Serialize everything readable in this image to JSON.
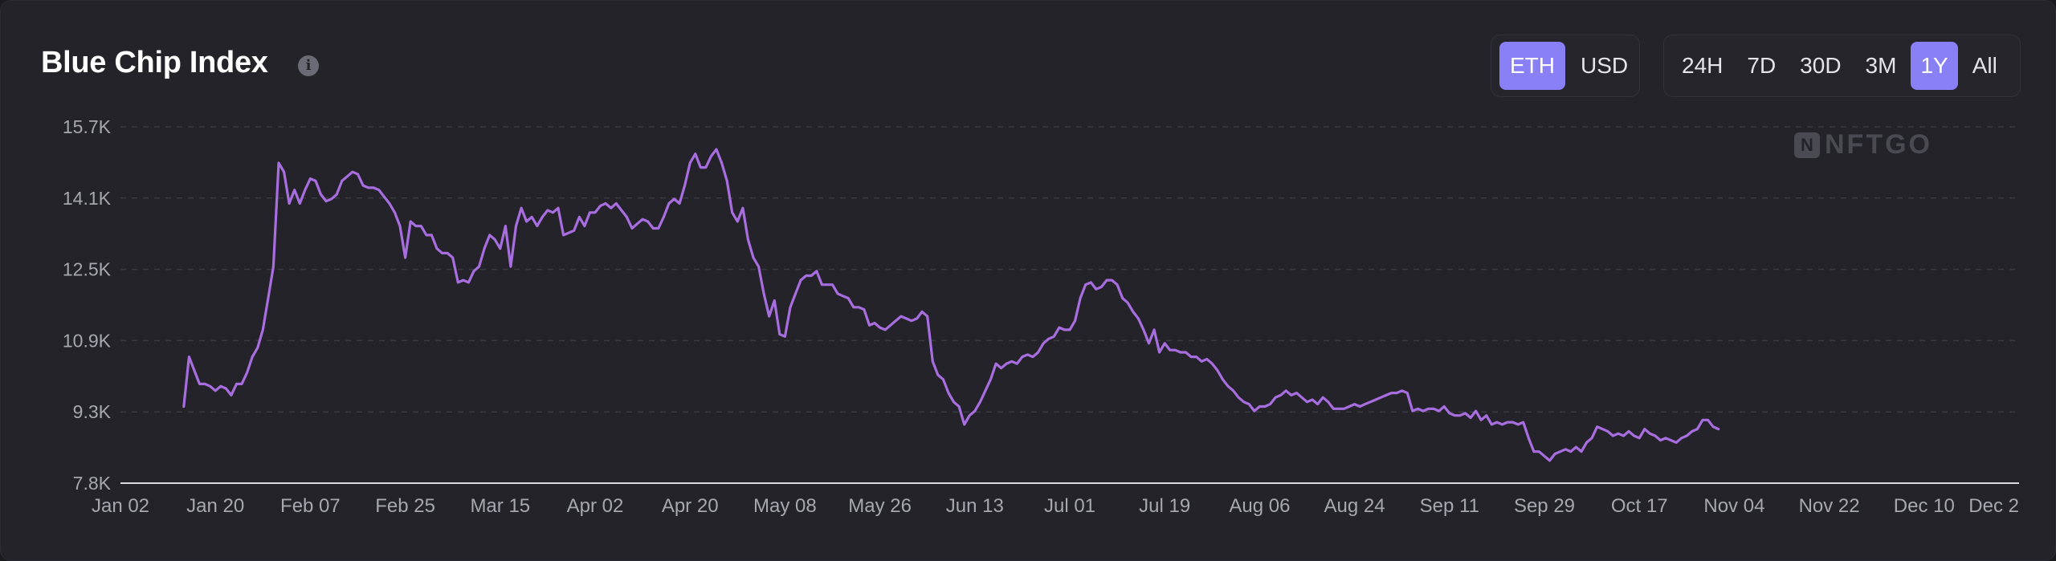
{
  "title": "Blue Chip Index",
  "currency": {
    "options": [
      "ETH",
      "USD"
    ],
    "selected": "ETH"
  },
  "ranges": {
    "options": [
      "24H",
      "7D",
      "30D",
      "3M",
      "1Y",
      "All"
    ],
    "selected": "1Y"
  },
  "watermark": "NFTGO",
  "colors": {
    "line": "#a86ee0",
    "accent": "#8a80f5",
    "background": "#232329"
  },
  "chart_data": {
    "type": "line",
    "title": "Blue Chip Index",
    "xlabel": "",
    "ylabel": "",
    "ylim": [
      7.8,
      15.7
    ],
    "y_ticks": [
      "15.7K",
      "14.1K",
      "12.5K",
      "10.9K",
      "9.3K",
      "7.8K"
    ],
    "x_ticks": [
      "Jan 02",
      "Jan 20",
      "Feb 07",
      "Feb 25",
      "Mar 15",
      "Apr 02",
      "Apr 20",
      "May 08",
      "May 26",
      "Jun 13",
      "Jul 01",
      "Jul 19",
      "Aug 06",
      "Aug 24",
      "Sep 11",
      "Sep 29",
      "Oct 17",
      "Nov 04",
      "Nov 22",
      "Dec 10",
      "Dec 2"
    ],
    "grid": true,
    "series": [
      {
        "points": [
          [
            12,
            9.5
          ],
          [
            13,
            10.6
          ],
          [
            14,
            10.3
          ],
          [
            15,
            10.0
          ],
          [
            16,
            10.0
          ],
          [
            17,
            9.95
          ],
          [
            18,
            9.85
          ],
          [
            19,
            9.95
          ],
          [
            20,
            9.9
          ],
          [
            21,
            9.75
          ],
          [
            22,
            10.0
          ],
          [
            23,
            10.0
          ],
          [
            24,
            10.25
          ],
          [
            25,
            10.6
          ],
          [
            26,
            10.8
          ],
          [
            27,
            11.2
          ],
          [
            28,
            11.9
          ],
          [
            29,
            12.6
          ],
          [
            30,
            14.9
          ],
          [
            31,
            14.7
          ],
          [
            32,
            14.0
          ],
          [
            33,
            14.3
          ],
          [
            34,
            14.0
          ],
          [
            35,
            14.3
          ],
          [
            36,
            14.55
          ],
          [
            37,
            14.5
          ],
          [
            38,
            14.2
          ],
          [
            39,
            14.05
          ],
          [
            40,
            14.1
          ],
          [
            41,
            14.2
          ],
          [
            42,
            14.5
          ],
          [
            43,
            14.6
          ],
          [
            44,
            14.7
          ],
          [
            45,
            14.65
          ],
          [
            46,
            14.4
          ],
          [
            47,
            14.35
          ],
          [
            48,
            14.35
          ],
          [
            49,
            14.3
          ],
          [
            50,
            14.15
          ],
          [
            51,
            14.0
          ],
          [
            52,
            13.8
          ],
          [
            53,
            13.5
          ],
          [
            54,
            12.8
          ],
          [
            55,
            13.6
          ],
          [
            56,
            13.5
          ],
          [
            57,
            13.5
          ],
          [
            58,
            13.3
          ],
          [
            59,
            13.3
          ],
          [
            60,
            13.0
          ],
          [
            61,
            12.9
          ],
          [
            62,
            12.9
          ],
          [
            63,
            12.8
          ],
          [
            64,
            12.25
          ],
          [
            65,
            12.3
          ],
          [
            66,
            12.25
          ],
          [
            67,
            12.5
          ],
          [
            68,
            12.6
          ],
          [
            69,
            13.0
          ],
          [
            70,
            13.3
          ],
          [
            71,
            13.2
          ],
          [
            72,
            13.0
          ],
          [
            73,
            13.5
          ],
          [
            74,
            12.6
          ],
          [
            75,
            13.5
          ],
          [
            76,
            13.9
          ],
          [
            77,
            13.6
          ],
          [
            78,
            13.7
          ],
          [
            79,
            13.5
          ],
          [
            80,
            13.7
          ],
          [
            81,
            13.85
          ],
          [
            82,
            13.8
          ],
          [
            83,
            13.9
          ],
          [
            84,
            13.3
          ],
          [
            85,
            13.35
          ],
          [
            86,
            13.4
          ],
          [
            87,
            13.7
          ],
          [
            88,
            13.5
          ],
          [
            89,
            13.8
          ],
          [
            90,
            13.8
          ],
          [
            91,
            13.95
          ],
          [
            92,
            14.0
          ],
          [
            93,
            13.9
          ],
          [
            94,
            14.0
          ],
          [
            95,
            13.85
          ],
          [
            96,
            13.7
          ],
          [
            97,
            13.45
          ],
          [
            98,
            13.55
          ],
          [
            99,
            13.65
          ],
          [
            100,
            13.6
          ],
          [
            101,
            13.45
          ],
          [
            102,
            13.45
          ],
          [
            103,
            13.7
          ],
          [
            104,
            14.0
          ],
          [
            105,
            14.1
          ],
          [
            106,
            14.0
          ],
          [
            107,
            14.4
          ],
          [
            108,
            14.9
          ],
          [
            109,
            15.1
          ],
          [
            110,
            14.8
          ],
          [
            111,
            14.8
          ],
          [
            112,
            15.05
          ],
          [
            113,
            15.2
          ],
          [
            114,
            14.9
          ],
          [
            115,
            14.5
          ],
          [
            116,
            13.8
          ],
          [
            117,
            13.6
          ],
          [
            118,
            13.9
          ],
          [
            119,
            13.2
          ],
          [
            120,
            12.8
          ],
          [
            121,
            12.6
          ],
          [
            122,
            12.0
          ],
          [
            123,
            11.5
          ],
          [
            124,
            11.85
          ],
          [
            125,
            11.1
          ],
          [
            126,
            11.05
          ],
          [
            127,
            11.7
          ],
          [
            128,
            12.0
          ],
          [
            129,
            12.3
          ],
          [
            130,
            12.4
          ],
          [
            131,
            12.4
          ],
          [
            132,
            12.5
          ],
          [
            133,
            12.2
          ],
          [
            134,
            12.2
          ],
          [
            135,
            12.2
          ],
          [
            136,
            12.0
          ],
          [
            137,
            11.95
          ],
          [
            138,
            11.9
          ],
          [
            139,
            11.7
          ],
          [
            140,
            11.7
          ],
          [
            141,
            11.65
          ],
          [
            142,
            11.3
          ],
          [
            143,
            11.35
          ],
          [
            144,
            11.25
          ],
          [
            145,
            11.2
          ],
          [
            146,
            11.3
          ],
          [
            147,
            11.4
          ],
          [
            148,
            11.5
          ],
          [
            149,
            11.45
          ],
          [
            150,
            11.4
          ],
          [
            151,
            11.45
          ],
          [
            152,
            11.6
          ],
          [
            153,
            11.5
          ],
          [
            154,
            10.5
          ],
          [
            155,
            10.2
          ],
          [
            156,
            10.1
          ],
          [
            157,
            9.8
          ],
          [
            158,
            9.6
          ],
          [
            159,
            9.5
          ],
          [
            160,
            9.1
          ],
          [
            161,
            9.3
          ],
          [
            162,
            9.4
          ],
          [
            163,
            9.6
          ],
          [
            164,
            9.85
          ],
          [
            165,
            10.1
          ],
          [
            166,
            10.45
          ],
          [
            167,
            10.35
          ],
          [
            168,
            10.45
          ],
          [
            169,
            10.5
          ],
          [
            170,
            10.45
          ],
          [
            171,
            10.6
          ],
          [
            172,
            10.65
          ],
          [
            173,
            10.6
          ],
          [
            174,
            10.7
          ],
          [
            175,
            10.9
          ],
          [
            176,
            11.0
          ],
          [
            177,
            11.05
          ],
          [
            178,
            11.25
          ],
          [
            179,
            11.2
          ],
          [
            180,
            11.2
          ],
          [
            181,
            11.4
          ],
          [
            182,
            11.9
          ],
          [
            183,
            12.2
          ],
          [
            184,
            12.25
          ],
          [
            185,
            12.1
          ],
          [
            186,
            12.15
          ],
          [
            187,
            12.3
          ],
          [
            188,
            12.3
          ],
          [
            189,
            12.2
          ],
          [
            190,
            11.9
          ],
          [
            191,
            11.8
          ],
          [
            192,
            11.6
          ],
          [
            193,
            11.45
          ],
          [
            194,
            11.2
          ],
          [
            195,
            10.9
          ],
          [
            196,
            11.2
          ],
          [
            197,
            10.7
          ],
          [
            198,
            10.9
          ],
          [
            199,
            10.75
          ],
          [
            200,
            10.75
          ],
          [
            201,
            10.7
          ],
          [
            202,
            10.7
          ],
          [
            203,
            10.6
          ],
          [
            204,
            10.6
          ],
          [
            205,
            10.5
          ],
          [
            206,
            10.55
          ],
          [
            207,
            10.45
          ],
          [
            208,
            10.3
          ],
          [
            209,
            10.1
          ],
          [
            210,
            9.95
          ],
          [
            211,
            9.85
          ],
          [
            212,
            9.7
          ],
          [
            213,
            9.6
          ],
          [
            214,
            9.55
          ],
          [
            215,
            9.4
          ],
          [
            216,
            9.5
          ],
          [
            217,
            9.5
          ],
          [
            218,
            9.55
          ],
          [
            219,
            9.7
          ],
          [
            220,
            9.75
          ],
          [
            221,
            9.85
          ],
          [
            222,
            9.75
          ],
          [
            223,
            9.8
          ],
          [
            224,
            9.7
          ],
          [
            225,
            9.6
          ],
          [
            226,
            9.65
          ],
          [
            227,
            9.55
          ],
          [
            228,
            9.7
          ],
          [
            229,
            9.6
          ],
          [
            230,
            9.45
          ],
          [
            231,
            9.45
          ],
          [
            232,
            9.45
          ],
          [
            233,
            9.5
          ],
          [
            234,
            9.55
          ],
          [
            235,
            9.5
          ],
          [
            236,
            9.55
          ],
          [
            237,
            9.6
          ],
          [
            238,
            9.65
          ],
          [
            239,
            9.7
          ],
          [
            240,
            9.75
          ],
          [
            241,
            9.8
          ],
          [
            242,
            9.8
          ],
          [
            243,
            9.85
          ],
          [
            244,
            9.8
          ],
          [
            245,
            9.4
          ],
          [
            246,
            9.45
          ],
          [
            247,
            9.4
          ],
          [
            248,
            9.45
          ],
          [
            249,
            9.45
          ],
          [
            250,
            9.4
          ],
          [
            251,
            9.5
          ],
          [
            252,
            9.35
          ],
          [
            253,
            9.3
          ],
          [
            254,
            9.3
          ],
          [
            255,
            9.35
          ],
          [
            256,
            9.25
          ],
          [
            257,
            9.4
          ],
          [
            258,
            9.2
          ],
          [
            259,
            9.3
          ],
          [
            260,
            9.1
          ],
          [
            261,
            9.15
          ],
          [
            262,
            9.1
          ],
          [
            263,
            9.15
          ],
          [
            264,
            9.15
          ],
          [
            265,
            9.1
          ],
          [
            266,
            9.15
          ],
          [
            267,
            8.8
          ],
          [
            268,
            8.5
          ],
          [
            269,
            8.5
          ],
          [
            270,
            8.4
          ],
          [
            271,
            8.3
          ],
          [
            272,
            8.45
          ],
          [
            273,
            8.5
          ],
          [
            274,
            8.55
          ],
          [
            275,
            8.5
          ],
          [
            276,
            8.6
          ],
          [
            277,
            8.5
          ],
          [
            278,
            8.7
          ],
          [
            279,
            8.8
          ],
          [
            280,
            9.05
          ],
          [
            281,
            9.0
          ],
          [
            282,
            8.95
          ],
          [
            283,
            8.85
          ],
          [
            284,
            8.9
          ],
          [
            285,
            8.85
          ],
          [
            286,
            8.95
          ],
          [
            287,
            8.85
          ],
          [
            288,
            8.8
          ],
          [
            289,
            9.0
          ],
          [
            290,
            8.9
          ],
          [
            291,
            8.85
          ],
          [
            292,
            8.75
          ],
          [
            293,
            8.8
          ],
          [
            294,
            8.75
          ],
          [
            295,
            8.7
          ],
          [
            296,
            8.8
          ],
          [
            297,
            8.85
          ],
          [
            298,
            8.95
          ],
          [
            299,
            9.0
          ],
          [
            300,
            9.2
          ],
          [
            301,
            9.2
          ],
          [
            302,
            9.05
          ],
          [
            303,
            9.0
          ]
        ]
      }
    ]
  }
}
